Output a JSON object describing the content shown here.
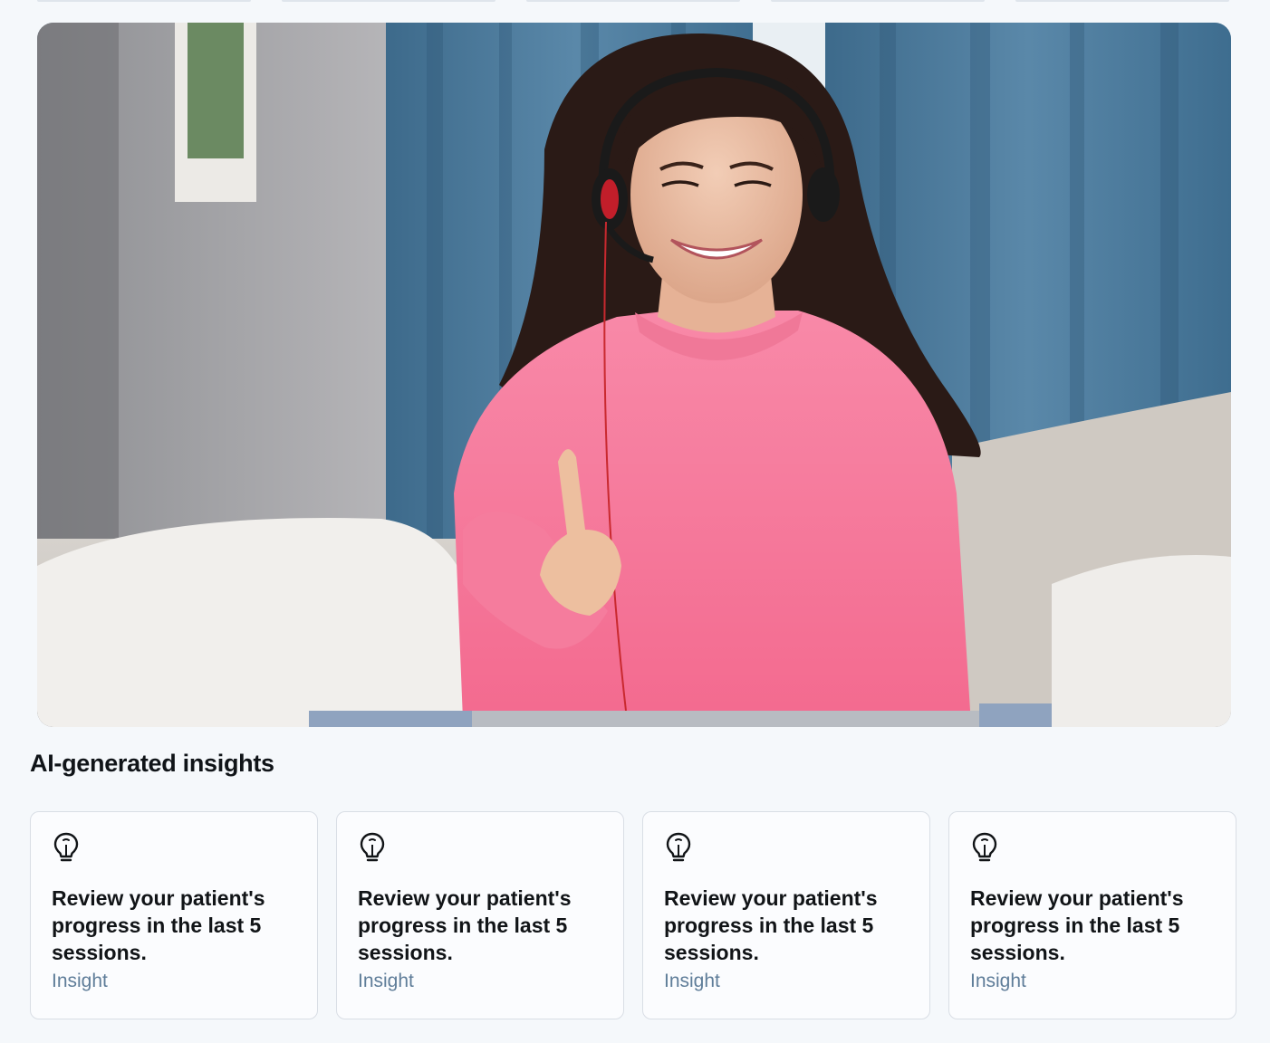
{
  "hero": {
    "description_icon": "video-session-image"
  },
  "insights": {
    "title": "AI-generated insights",
    "cards": [
      {
        "icon": "lightbulb-icon",
        "text": "Review your patient's progress in the last 5 sessions.",
        "tag": "Insight"
      },
      {
        "icon": "lightbulb-icon",
        "text": "Review your patient's progress in the last 5 sessions.",
        "tag": "Insight"
      },
      {
        "icon": "lightbulb-icon",
        "text": "Review your patient's progress in the last 5 sessions.",
        "tag": "Insight"
      },
      {
        "icon": "lightbulb-icon",
        "text": "Review your patient's progress in the last 5 sessions.",
        "tag": "Insight"
      }
    ]
  },
  "colors": {
    "background": "#f5f8fb",
    "card_border": "#d9dee5",
    "tag_text": "#5f7d99",
    "title_text": "#101418"
  }
}
